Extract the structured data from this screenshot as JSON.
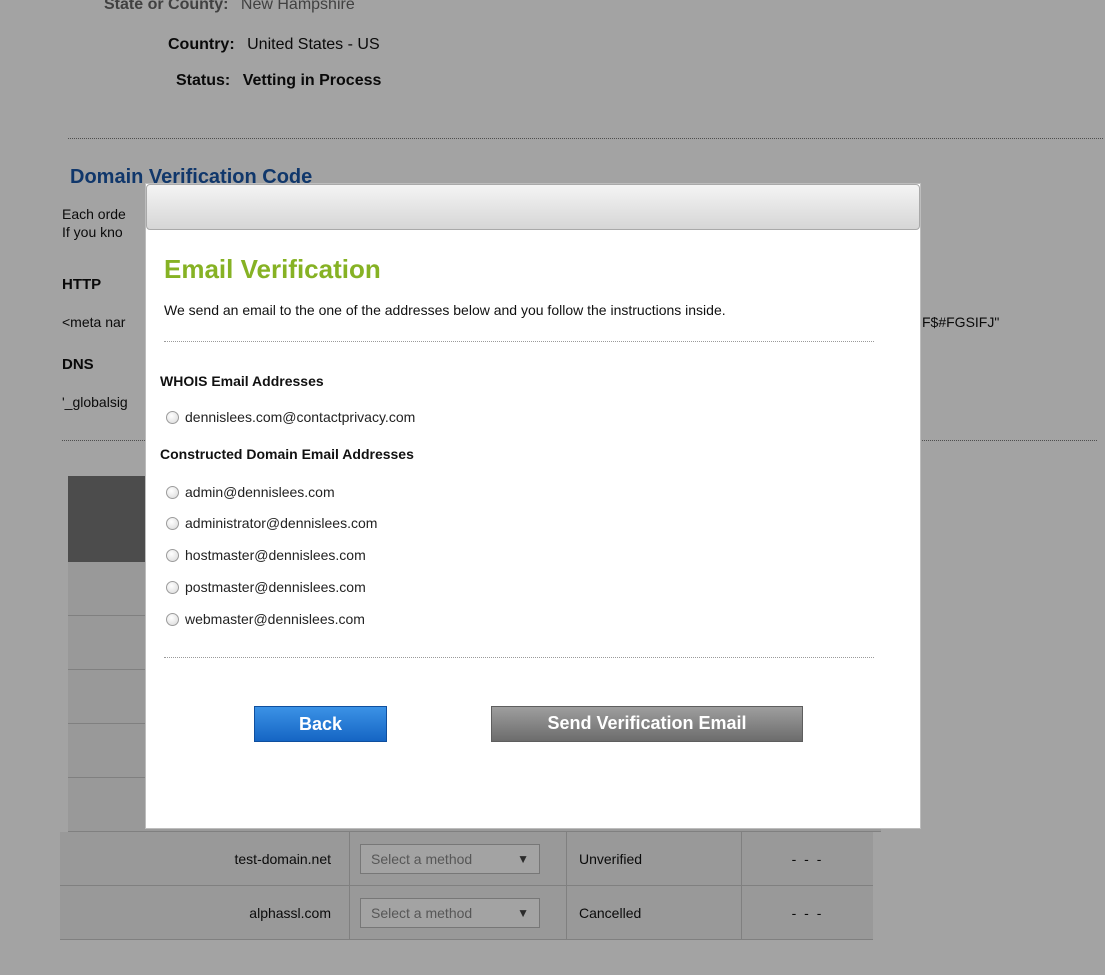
{
  "background": {
    "partial_label": "State or County:",
    "partial_value": "New Hampshire",
    "country_label": "Country:",
    "country_value": "United States - US",
    "status_label": "Status:",
    "status_value": "Vetting in Process",
    "section_title": "Domain Verification Code",
    "intro_line_1": "Each orde",
    "intro_line_2": "If you kno",
    "http_heading": "HTTP",
    "http_code_left": "<meta nar",
    "http_code_right": "F$#FGSIFJ\"",
    "dns_heading": "DNS",
    "dns_code_left": "'_globalsig",
    "table": {
      "rows": [
        {
          "domain": "test-domain.net",
          "method": "Select a method",
          "status": "Unverified",
          "action": "- - -"
        },
        {
          "domain": "alphassl.com",
          "method": "Select a method",
          "status": "Cancelled",
          "action": "- - -"
        }
      ]
    }
  },
  "modal": {
    "title": "Email Verification",
    "description": "We send an email to the one of the addresses below and you follow the instructions inside.",
    "whois_heading": "WHOIS Email Addresses",
    "whois_options": [
      "dennislees.com@contactprivacy.com"
    ],
    "constructed_heading": "Constructed Domain Email Addresses",
    "constructed_options": [
      "admin@dennislees.com",
      "administrator@dennislees.com",
      "hostmaster@dennislees.com",
      "postmaster@dennislees.com",
      "webmaster@dennislees.com"
    ],
    "back_label": "Back",
    "send_label": "Send Verification Email"
  },
  "colors": {
    "heading_green": "#86b224",
    "section_blue": "#1a56a8",
    "back_button_blue": "#1565c4",
    "send_button_gray": "#6c6c6c"
  }
}
